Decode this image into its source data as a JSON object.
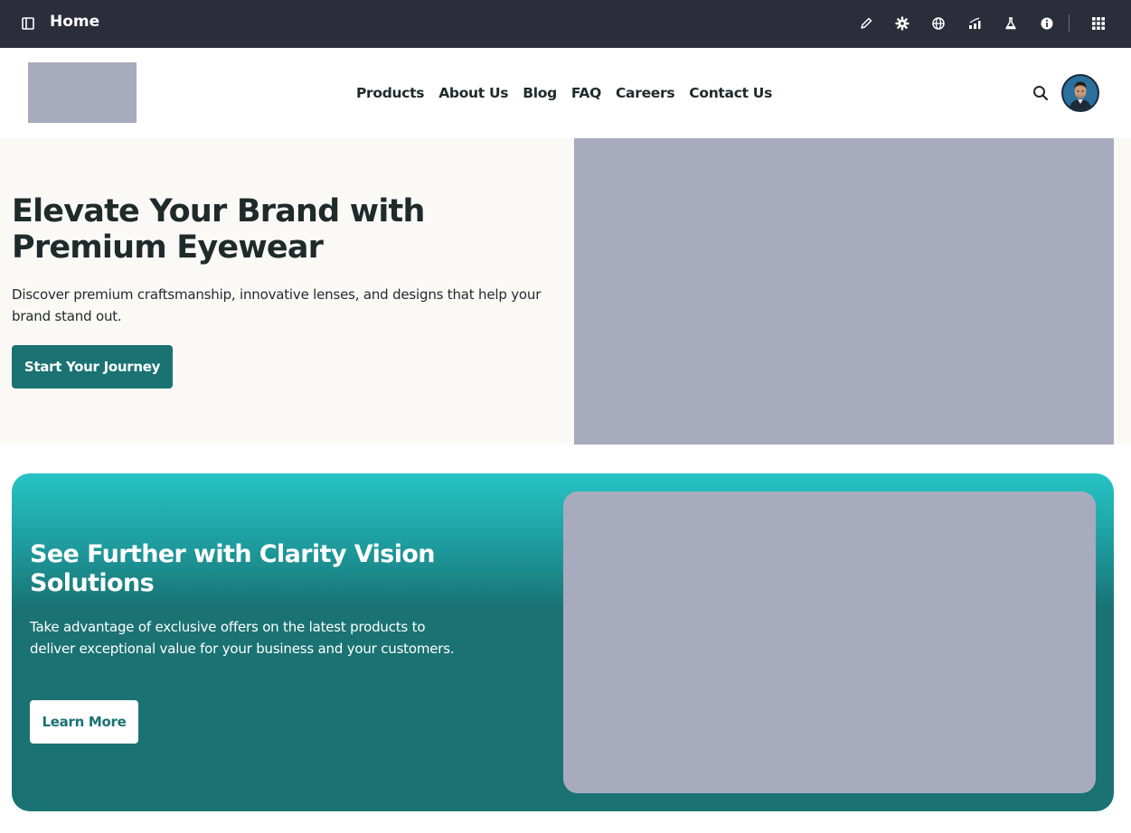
{
  "editor_bar": {
    "title": "Home",
    "tools": [
      "pencil-icon",
      "gear-icon",
      "globe-icon",
      "chart-icon",
      "flask-icon",
      "info-icon",
      "apps-grid-icon"
    ]
  },
  "header": {
    "nav": [
      "Products",
      "About Us",
      "Blog",
      "FAQ",
      "Careers",
      "Contact Us"
    ]
  },
  "hero": {
    "title": "Elevate Your Brand with Premium Eyewear",
    "subtitle": "Discover premium craftsmanship, innovative lenses, and designs that help your brand stand out.",
    "cta_label": "Start Your Journey"
  },
  "promo": {
    "title": "See Further with Clarity Vision Solutions",
    "body": "Take advantage of exclusive offers on the latest products to deliver exceptional value for your business and your customers.",
    "cta_label": "Learn More"
  },
  "colors": {
    "editor_bar_bg": "#2b2d3a",
    "brand_teal": "#1a7273",
    "gradient_top": "#26c4c5",
    "hero_bg": "#fbf9f5",
    "placeholder": "#a8abbd",
    "text_dark": "#1f2a2b"
  }
}
